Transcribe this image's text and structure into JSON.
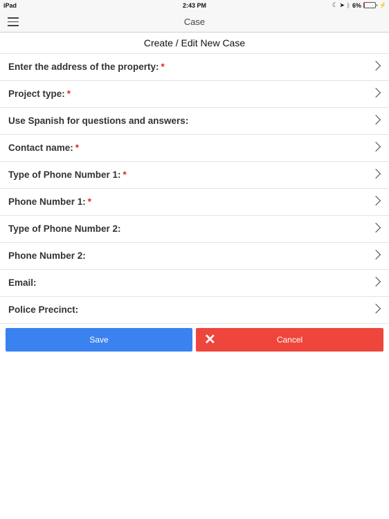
{
  "status_bar": {
    "device": "iPad",
    "time": "2:43 PM",
    "battery_percent": "6%",
    "battery_level": 0.06,
    "icons": [
      "moon-icon",
      "location-arrow-icon",
      "bluetooth-icon",
      "battery-icon",
      "charging-bolt-icon"
    ]
  },
  "navbar": {
    "title": "Case",
    "menu_icon": "hamburger-menu-icon"
  },
  "page": {
    "subtitle": "Create / Edit New Case"
  },
  "form": {
    "required_marker": "*",
    "fields": [
      {
        "label": "Enter the address of the property:",
        "required": true
      },
      {
        "label": "Project type:",
        "required": true
      },
      {
        "label": "Use Spanish for questions and answers:",
        "required": false
      },
      {
        "label": "Contact name:",
        "required": true
      },
      {
        "label": "Type of Phone Number 1:",
        "required": true
      },
      {
        "label": "Phone Number 1:",
        "required": true
      },
      {
        "label": "Type of Phone Number 2:",
        "required": false
      },
      {
        "label": "Phone Number 2:",
        "required": false
      },
      {
        "label": "Email:",
        "required": false
      },
      {
        "label": "Police Precinct:",
        "required": false
      }
    ]
  },
  "actions": {
    "save_label": "Save",
    "cancel_label": "Cancel",
    "cancel_icon": "✕",
    "save_color": "#3a82f0",
    "cancel_color": "#ee463c"
  }
}
